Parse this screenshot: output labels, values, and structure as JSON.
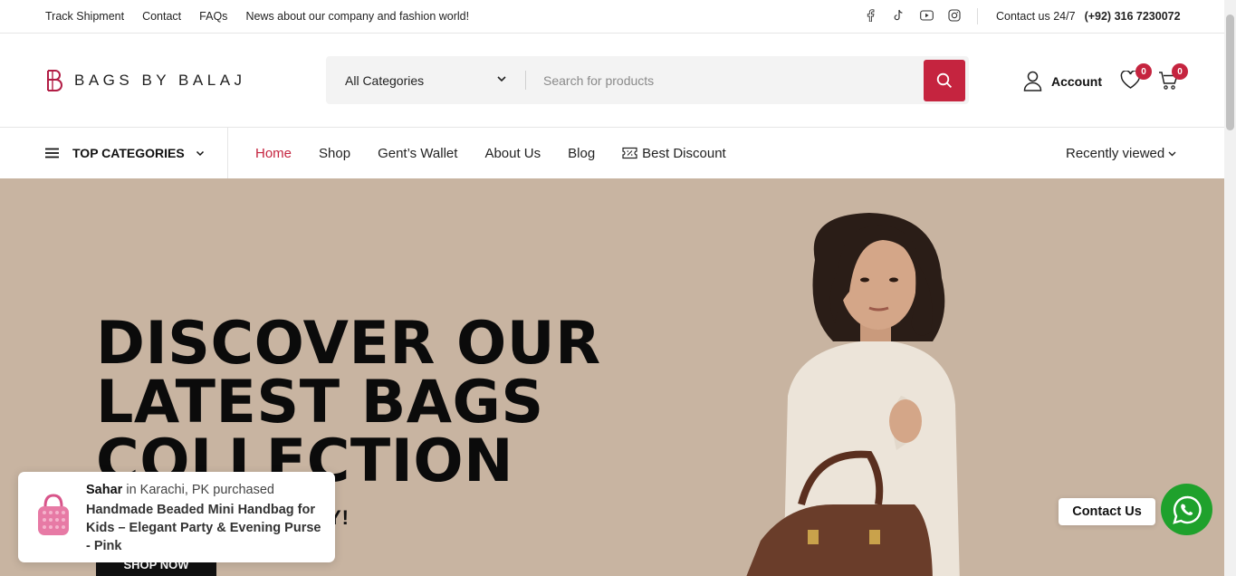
{
  "topbar": {
    "links": [
      "Track Shipment",
      "Contact",
      "FAQs",
      "News about our company and fashion world!"
    ],
    "social_icons": [
      "facebook-icon",
      "tiktok-icon",
      "youtube-icon",
      "instagram-icon"
    ],
    "contact_label": "Contact us 24/7",
    "phone": "(+92) 316 7230072"
  },
  "header": {
    "logo_text": "BAGS BY BALAJ",
    "category_select": "All Categories",
    "search_placeholder": "Search for products",
    "account_label": "Account",
    "wishlist_count": "0",
    "cart_count": "0"
  },
  "nav": {
    "top_categories": "TOP CATEGORIES",
    "items": [
      "Home",
      "Shop",
      "Gent’s Wallet",
      "About Us",
      "Blog",
      "Best Discount"
    ],
    "active": "Home",
    "recently_viewed": "Recently viewed"
  },
  "hero": {
    "title_line1": "DISCOVER OUR",
    "title_line2": "LATEST BAGS",
    "title_line3": "COLLECTION",
    "subtitle_visible": "Y!",
    "button": "SHOP NOW"
  },
  "popup": {
    "buyer": "Sahar",
    "location": "in Karachi, PK purchased",
    "product": "Handmade Beaded Mini Handbag for Kids – Elegant Party & Evening Purse - Pink"
  },
  "whatsapp": {
    "label": "Contact Us"
  },
  "colors": {
    "accent": "#c5243f",
    "hero_bg": "#c8b4a1",
    "whatsapp": "#1fa12c"
  }
}
